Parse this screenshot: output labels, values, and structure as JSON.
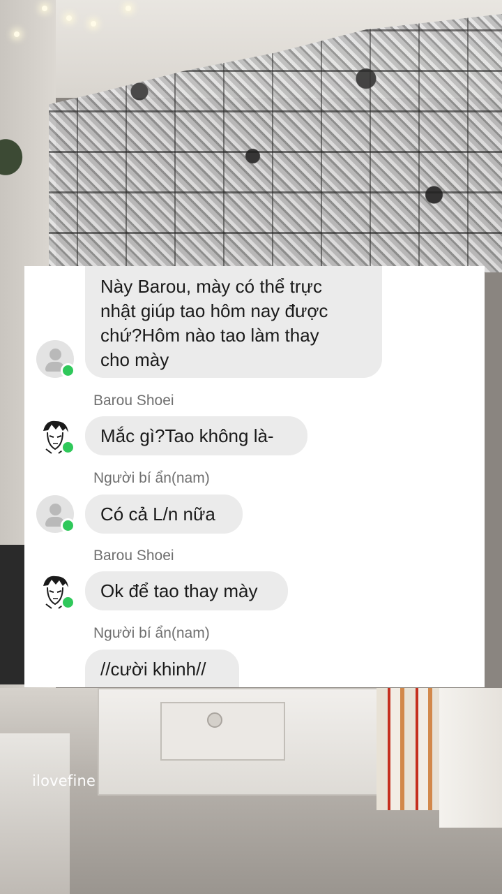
{
  "watermark": "ilovefine",
  "messages": [
    {
      "sender": "",
      "text": "Này Barou, mày có thể trực nhật giúp tao hôm nay được chứ?Hôm nào tao làm thay cho mày",
      "lines": [
        "Này Barou, mày có thể trực",
        "nhật giúp tao hôm nay được",
        "chứ?Hôm nào tao làm thay",
        "cho mày"
      ]
    },
    {
      "sender": "Barou Shoei",
      "text": "Mắc gì?Tao không là-"
    },
    {
      "sender": "Người bí ẩn(nam)",
      "text": "Có cả L/n nữa"
    },
    {
      "sender": "Barou Shoei",
      "text": "Ok để tao thay mày"
    },
    {
      "sender": "Người bí ẩn(nam)",
      "text": "//cười khinh//"
    }
  ],
  "colors": {
    "bubble": "#ebebeb",
    "online": "#2fc85a",
    "name": "#6f6f6f"
  },
  "icons": {
    "default_avatar": "person-placeholder-icon",
    "barou_avatar": "manga-portrait-icon",
    "status": "online-dot-icon"
  }
}
